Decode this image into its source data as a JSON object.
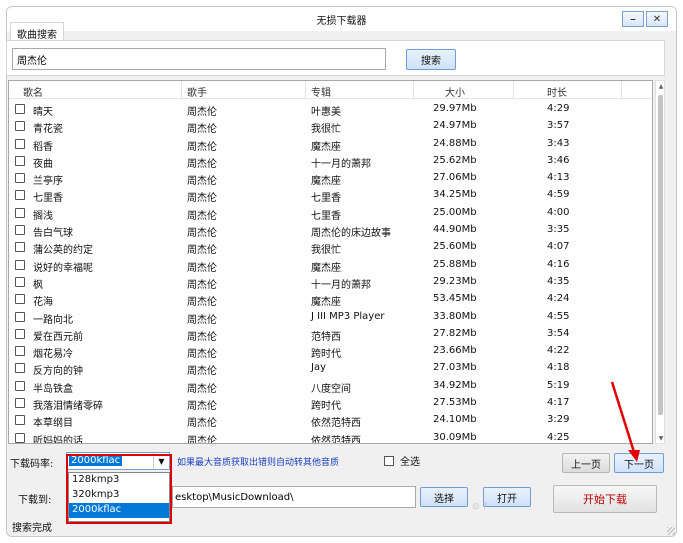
{
  "window": {
    "title": "无损下载器"
  },
  "window_buttons": [
    "⎯",
    "✕"
  ],
  "search": {
    "tab_label": "歌曲搜索",
    "query": "周杰伦",
    "button_label": "搜索"
  },
  "table": {
    "headers": [
      "歌名",
      "歌手",
      "专辑",
      "大小",
      "时长"
    ],
    "rows": [
      {
        "title": "晴天",
        "artist": "周杰伦",
        "album": "叶惠美",
        "size": "29.97Mb",
        "duration": "4:29"
      },
      {
        "title": "青花瓷",
        "artist": "周杰伦",
        "album": "我很忙",
        "size": "24.97Mb",
        "duration": "3:57"
      },
      {
        "title": "稻香",
        "artist": "周杰伦",
        "album": "魔杰座",
        "size": "24.88Mb",
        "duration": "3:43"
      },
      {
        "title": "夜曲",
        "artist": "周杰伦",
        "album": "十一月的萧邦",
        "size": "25.62Mb",
        "duration": "3:46"
      },
      {
        "title": "兰亭序",
        "artist": "周杰伦",
        "album": "魔杰座",
        "size": "27.06Mb",
        "duration": "4:13"
      },
      {
        "title": "七里香",
        "artist": "周杰伦",
        "album": "七里香",
        "size": "34.25Mb",
        "duration": "4:59"
      },
      {
        "title": "搁浅",
        "artist": "周杰伦",
        "album": "七里香",
        "size": "25.00Mb",
        "duration": "4:00"
      },
      {
        "title": "告白气球",
        "artist": "周杰伦",
        "album": "周杰伦的床边故事",
        "size": "44.90Mb",
        "duration": "3:35"
      },
      {
        "title": "蒲公英的约定",
        "artist": "周杰伦",
        "album": "我很忙",
        "size": "25.60Mb",
        "duration": "4:07"
      },
      {
        "title": "说好的幸福呢",
        "artist": "周杰伦",
        "album": "魔杰座",
        "size": "25.88Mb",
        "duration": "4:16"
      },
      {
        "title": "枫",
        "artist": "周杰伦",
        "album": "十一月的萧邦",
        "size": "29.23Mb",
        "duration": "4:35"
      },
      {
        "title": "花海",
        "artist": "周杰伦",
        "album": "魔杰座",
        "size": "53.45Mb",
        "duration": "4:24"
      },
      {
        "title": "一路向北",
        "artist": "周杰伦",
        "album": "J III MP3 Player",
        "size": "33.80Mb",
        "duration": "4:55"
      },
      {
        "title": "爱在西元前",
        "artist": "周杰伦",
        "album": "范特西",
        "size": "27.82Mb",
        "duration": "3:54"
      },
      {
        "title": "烟花易冷",
        "artist": "周杰伦",
        "album": "跨时代",
        "size": "23.66Mb",
        "duration": "4:22"
      },
      {
        "title": "反方向的钟",
        "artist": "周杰伦",
        "album": "Jay",
        "size": "27.03Mb",
        "duration": "4:18"
      },
      {
        "title": "半岛铁盒",
        "artist": "周杰伦",
        "album": "八度空间",
        "size": "34.92Mb",
        "duration": "5:19"
      },
      {
        "title": "我落泪情绪零碎",
        "artist": "周杰伦",
        "album": "跨时代",
        "size": "27.53Mb",
        "duration": "4:17"
      },
      {
        "title": "本草纲目",
        "artist": "周杰伦",
        "album": "依然范特西",
        "size": "24.10Mb",
        "duration": "3:29"
      },
      {
        "title": "听妈妈的话",
        "artist": "周杰伦",
        "album": "依然范特西",
        "size": "30.09Mb",
        "duration": "4:25"
      }
    ]
  },
  "controls": {
    "bitrate_label": "下载码率:",
    "bitrate_selected": "2000kflac",
    "bitrate_options": [
      "128kmp3",
      "320kmp3",
      "2000kflac"
    ],
    "hint": "如果最大音质获取出错则自动转其他音质",
    "select_all_label": "全选",
    "prev_page": "上一页",
    "next_page": "下一页",
    "download_to_label": "下载到:",
    "download_path": "esktop\\MusicDownload\\",
    "choose_button": "选择",
    "open_button": "打开",
    "start_download": "开始下载",
    "status": "搜索完成"
  },
  "watermark": "⊙ ?",
  "colors": {
    "accent_red": "#e00000",
    "selection_blue": "#0078d7",
    "hint_blue": "#1a3fbf"
  }
}
